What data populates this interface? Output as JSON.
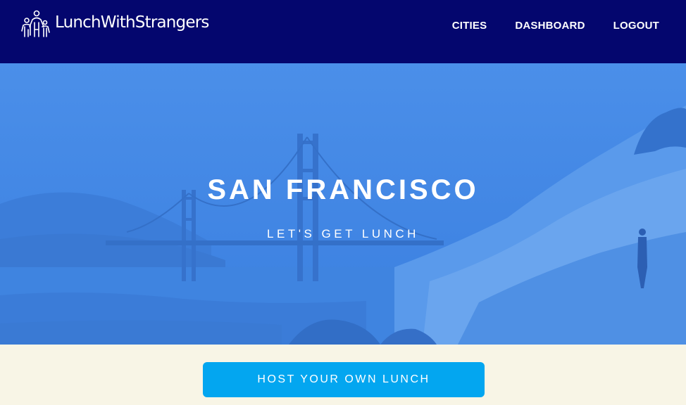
{
  "brand": {
    "name": "LunchWithStrangers",
    "icon": "people-group-icon"
  },
  "nav": {
    "items": [
      {
        "label": "CITIES"
      },
      {
        "label": "DASHBOARD"
      },
      {
        "label": "LOGOUT"
      }
    ]
  },
  "hero": {
    "title": "SAN FRANCISCO",
    "subtitle": "LET'S GET LUNCH",
    "background": "golden-gate-bridge-photo"
  },
  "cta": {
    "label": "HOST YOUR OWN LUNCH"
  },
  "colors": {
    "navbar": "#04066e",
    "hero_tint": "#3f86e6",
    "cta_button": "#03a6f0",
    "page_bg": "#f8f5e6"
  }
}
